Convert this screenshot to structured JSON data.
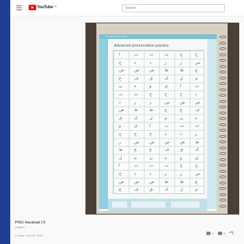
{
  "header": {
    "logo_text": "YouTube",
    "logo_sup": "ZW",
    "search_placeholder": "Search"
  },
  "player": {
    "book_header": "Learning to read Arabic",
    "book_title": "Advanced pronunciation practice",
    "grid_chars": [
      "ا",
      "ب",
      "ت",
      "ث",
      "ج",
      "ح",
      "خ",
      "د",
      "ذ",
      "ر",
      "ز",
      "س",
      "ش",
      "ص",
      "ض",
      "ط",
      "ظ",
      "ع",
      "غ",
      "ف",
      "ق",
      "ك",
      "ل",
      "م",
      "ن",
      "ه",
      "و",
      "ي"
    ]
  },
  "video": {
    "title": "P061 Harakaat L5",
    "visibility": "Unlisted",
    "meta": "2 views • Feb 10, 2020",
    "likes": "0",
    "dislikes": "0"
  },
  "colors": {
    "sidebar_strip": "#1f3f93",
    "brand_red": "#ff0000",
    "book_blue": "#7ac2d6"
  },
  "icons": [
    "menu-icon",
    "youtube-logo-icon",
    "like-icon",
    "dislike-icon",
    "share-icon"
  ]
}
